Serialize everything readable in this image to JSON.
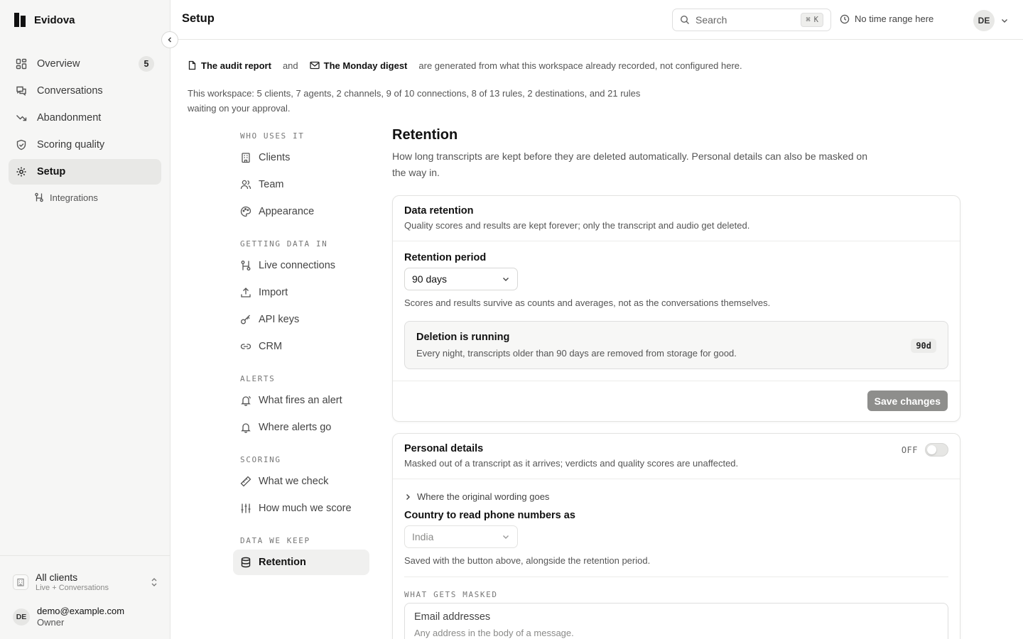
{
  "app": {
    "name": "Evidova"
  },
  "sidebar": {
    "items": [
      {
        "label": "Overview",
        "badge": "5"
      },
      {
        "label": "Conversations"
      },
      {
        "label": "Abandonment"
      },
      {
        "label": "Scoring quality"
      },
      {
        "label": "Setup"
      }
    ],
    "sub_items": [
      {
        "label": "Integrations"
      }
    ],
    "client_switcher": {
      "label": "All clients",
      "sub": "Live + Conversations"
    },
    "user": {
      "initials": "DE",
      "email": "demo@example.com",
      "role": "Owner"
    }
  },
  "header": {
    "title": "Setup",
    "search_label": "Search",
    "shortcut_symbol": "⌘",
    "shortcut_key": "K",
    "time_range": "No time range here",
    "user_initials": "DE"
  },
  "notice": {
    "link_1": "The audit report",
    "connector": "and",
    "link_2": "The Monday digest",
    "suffix": "are generated from what this workspace already recorded, not configured here."
  },
  "workspace_summary": "This workspace: 5 clients, 7 agents, 2 channels, 9 of 10 connections, 8 of 13 rules, 2 destinations, and 21 rules waiting on your approval.",
  "subnav": {
    "groups": [
      {
        "heading": "WHO USES IT",
        "items": [
          "Clients",
          "Team",
          "Appearance"
        ]
      },
      {
        "heading": "GETTING DATA IN",
        "items": [
          "Live connections",
          "Import",
          "API keys",
          "CRM"
        ]
      },
      {
        "heading": "ALERTS",
        "items": [
          "What fires an alert",
          "Where alerts go"
        ]
      },
      {
        "heading": "SCORING",
        "items": [
          "What we check",
          "How much we score"
        ]
      },
      {
        "heading": "DATA WE KEEP",
        "items": [
          "Retention"
        ]
      }
    ]
  },
  "retention": {
    "title": "Retention",
    "description": "How long transcripts are kept before they are deleted automatically. Personal details can also be masked on the way in.",
    "data_card": {
      "title": "Data retention",
      "subtitle": "Quality scores and results are kept forever; only the transcript and audio get deleted.",
      "period_label": "Retention period",
      "period_value": "90 days",
      "period_hint": "Scores and results survive as counts and averages, not as the conversations themselves.",
      "status_title": "Deletion is running",
      "status_text": "Every night, transcripts older than 90 days are removed from storage for good.",
      "status_chip": "90d",
      "save_label": "Save changes"
    },
    "personal_card": {
      "title": "Personal details",
      "subtitle": "Masked out of a transcript as it arrives; verdicts and quality scores are unaffected.",
      "toggle_label": "OFF",
      "toggle_on": false,
      "expander_label": "Where the original wording goes",
      "country_label": "Country to read phone numbers as",
      "country_value": "India",
      "country_hint": "Saved with the button above, alongside the retention period.",
      "masked_heading": "WHAT GETS MASKED",
      "mask_options": [
        {
          "title": "Email addresses",
          "subtitle": "Any address in the body of a message."
        }
      ]
    }
  }
}
